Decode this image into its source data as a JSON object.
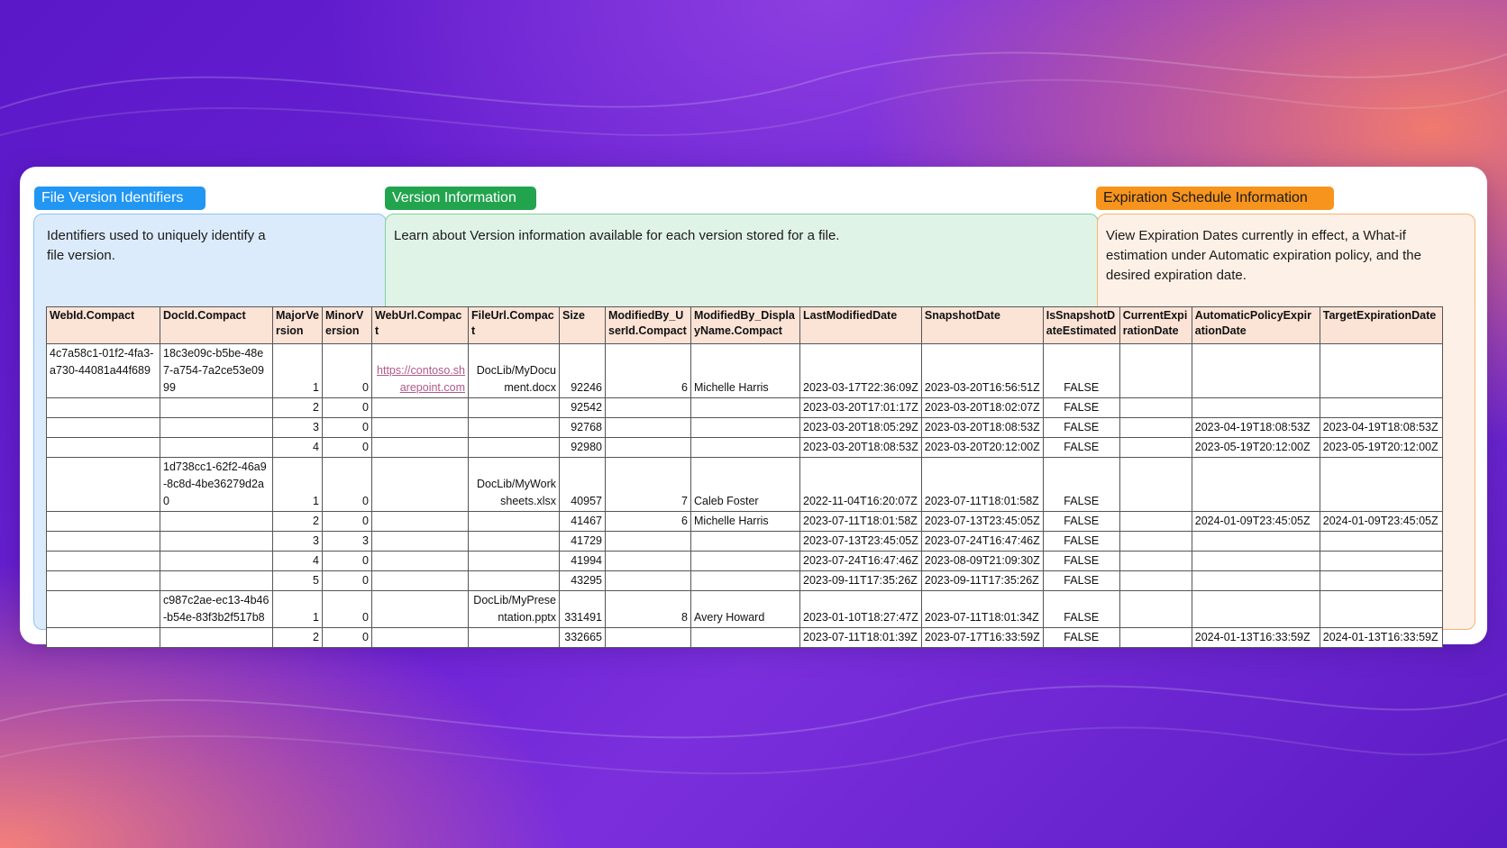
{
  "sections": {
    "identifiers": {
      "label": "File Version Identifiers",
      "description": "Identifiers used to uniquely identify a file version.",
      "color": "#2196f3"
    },
    "version": {
      "label": "Version Information",
      "description": "Learn about Version information available for each version stored for a file.",
      "color": "#22a44f"
    },
    "expiration": {
      "label": "Expiration Schedule Information",
      "description": "View Expiration Dates currently in effect, a What-if estimation under Automatic expiration policy, and the desired expiration date.",
      "color": "#f7941d"
    }
  },
  "table": {
    "headers": [
      "WebId.Compact",
      "DocId.Compact",
      "MajorVersion",
      "MinorVersion",
      "WebUrl.Compact",
      "FileUrl.Compact",
      "Size",
      "ModifiedBy_UserId.Compact",
      "ModifiedBy_DisplayName.Compact",
      "LastModifiedDate",
      "SnapshotDate",
      "IsSnapshotDateEstimated",
      "CurrentExpirationDate",
      "AutomaticPolicyExpirationDate",
      "TargetExpirationDate"
    ],
    "rows": [
      [
        "4c7a58c1-01f2-4fa3-a730-44081a44f689",
        "18c3e09c-b5be-48e7-a754-7a2ce53e0999",
        "1",
        "0",
        "https://contoso.sharepoint.com",
        "DocLib/MyDocument.docx",
        "92246",
        "6",
        "Michelle Harris",
        "2023-03-17T22:36:09Z",
        "2023-03-20T16:56:51Z",
        "FALSE",
        "",
        "",
        ""
      ],
      [
        "",
        "",
        "2",
        "0",
        "",
        "",
        "92542",
        "",
        "",
        "2023-03-20T17:01:17Z",
        "2023-03-20T18:02:07Z",
        "FALSE",
        "",
        "",
        ""
      ],
      [
        "",
        "",
        "3",
        "0",
        "",
        "",
        "92768",
        "",
        "",
        "2023-03-20T18:05:29Z",
        "2023-03-20T18:08:53Z",
        "FALSE",
        "",
        "2023-04-19T18:08:53Z",
        "2023-04-19T18:08:53Z"
      ],
      [
        "",
        "",
        "4",
        "0",
        "",
        "",
        "92980",
        "",
        "",
        "2023-03-20T18:08:53Z",
        "2023-03-20T20:12:00Z",
        "FALSE",
        "",
        "2023-05-19T20:12:00Z",
        "2023-05-19T20:12:00Z"
      ],
      [
        "",
        "1d738cc1-62f2-46a9-8c8d-4be36279d2a0",
        "1",
        "0",
        "",
        "DocLib/MyWorksheets.xlsx",
        "40957",
        "7",
        "Caleb Foster",
        "2022-11-04T16:20:07Z",
        "2023-07-11T18:01:58Z",
        "FALSE",
        "",
        "",
        ""
      ],
      [
        "",
        "",
        "2",
        "0",
        "",
        "",
        "41467",
        "6",
        "Michelle Harris",
        "2023-07-11T18:01:58Z",
        "2023-07-13T23:45:05Z",
        "FALSE",
        "",
        "2024-01-09T23:45:05Z",
        "2024-01-09T23:45:05Z"
      ],
      [
        "",
        "",
        "3",
        "3",
        "",
        "",
        "41729",
        "",
        "",
        "2023-07-13T23:45:05Z",
        "2023-07-24T16:47:46Z",
        "FALSE",
        "",
        "",
        ""
      ],
      [
        "",
        "",
        "4",
        "0",
        "",
        "",
        "41994",
        "",
        "",
        "2023-07-24T16:47:46Z",
        "2023-08-09T21:09:30Z",
        "FALSE",
        "",
        "",
        ""
      ],
      [
        "",
        "",
        "5",
        "0",
        "",
        "",
        "43295",
        "",
        "",
        "2023-09-11T17:35:26Z",
        "2023-09-11T17:35:26Z",
        "FALSE",
        "",
        "",
        ""
      ],
      [
        "",
        "c987c2ae-ec13-4b46-b54e-83f3b2f517b8",
        "1",
        "0",
        "",
        "DocLib/MyPresentation.pptx",
        "331491",
        "8",
        "Avery Howard",
        "2023-01-10T18:27:47Z",
        "2023-07-11T18:01:34Z",
        "FALSE",
        "",
        "",
        ""
      ],
      [
        "",
        "",
        "2",
        "0",
        "",
        "",
        "332665",
        "",
        "",
        "2023-07-11T18:01:39Z",
        "2023-07-17T16:33:59Z",
        "FALSE",
        "",
        "2024-01-13T16:33:59Z",
        "2024-01-13T16:33:59Z"
      ]
    ]
  }
}
